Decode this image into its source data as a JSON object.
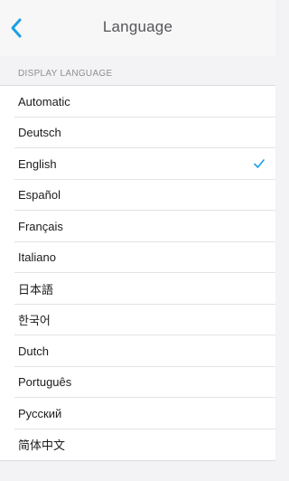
{
  "nav": {
    "title": "Language",
    "back_icon": "chevron-left-icon"
  },
  "section": {
    "header": "DISPLAY LANGUAGE"
  },
  "languages": [
    {
      "label": "Automatic",
      "selected": false
    },
    {
      "label": "Deutsch",
      "selected": false
    },
    {
      "label": "English",
      "selected": true
    },
    {
      "label": "Español",
      "selected": false
    },
    {
      "label": "Français",
      "selected": false
    },
    {
      "label": "Italiano",
      "selected": false
    },
    {
      "label": "日本語",
      "selected": false
    },
    {
      "label": "한국어",
      "selected": false
    },
    {
      "label": "Dutch",
      "selected": false
    },
    {
      "label": "Português",
      "selected": false
    },
    {
      "label": "Русский",
      "selected": false
    },
    {
      "label": "简体中文",
      "selected": false
    }
  ],
  "colors": {
    "accent": "#1aa0e6",
    "background": "#f3f3f5",
    "row_background": "#ffffff"
  }
}
